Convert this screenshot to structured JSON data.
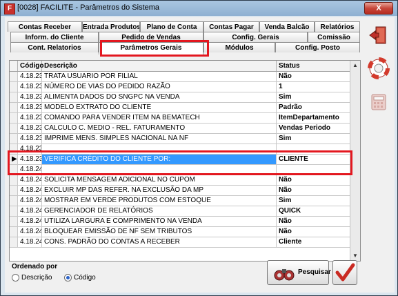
{
  "window": {
    "title": "[0028] FACILITE - Parâmetros do Sistema",
    "close_label": "X"
  },
  "tabs": {
    "row1": [
      "Contas Receber",
      "Entrada Produtos",
      "Plano de Conta",
      "Contas Pagar",
      "Venda Balcão",
      "Relatórios"
    ],
    "row2": [
      "Inform. do Cliente",
      "Pedido de Vendas",
      "Config. Gerais",
      "Comissão"
    ],
    "row3": [
      "Cont. Relatorios",
      "Parâmetros Gerais",
      "Módulos",
      "Config. Posto"
    ]
  },
  "grid": {
    "headers": [
      "Código",
      "Descrição",
      "Status"
    ],
    "rows": [
      {
        "code": "4.18.231",
        "desc": "TRATA USUARIO POR FILIAL",
        "status": "Não"
      },
      {
        "code": "4.18.232",
        "desc": "NÚMERO DE VIAS DO PEDIDO RAZÃO",
        "status": "1"
      },
      {
        "code": "4.18.233",
        "desc": "ALIMENTA DADOS DO SNGPC NA VENDA",
        "status": "Sim"
      },
      {
        "code": "4.18.234",
        "desc": "MODELO EXTRATO DO CLIENTE",
        "status": "Padrão"
      },
      {
        "code": "4.18.235",
        "desc": "COMANDO PARA VENDER ITEM NA BEMATECH",
        "status": "ItemDepartamento"
      },
      {
        "code": "4.18.236",
        "desc": "CALCULO C. MEDIO - REL. FATURAMENTO",
        "status": "Vendas Periodo"
      },
      {
        "code": "4.18.237",
        "desc": "IMPRIME MENS. SIMPLES NACIONAL NA NF",
        "status": "Sim"
      },
      {
        "code": "4.18.238",
        "desc": "",
        "status": ""
      },
      {
        "code": "4.18.239",
        "desc": "VERIFICA CRÉDITO DO CLIENTE POR:",
        "status": "CLIENTE"
      },
      {
        "code": "4.18.240",
        "desc": "",
        "status": ""
      },
      {
        "code": "4.18.241",
        "desc": "SOLICITA MENSAGEM ADICIONAL NO CUPOM",
        "status": "Não"
      },
      {
        "code": "4.18.242",
        "desc": "EXCLUIR MP DAS REFER. NA EXCLUSÃO DA MP",
        "status": "Não"
      },
      {
        "code": "4.18.243",
        "desc": "MOSTRAR EM VERDE PRODUTOS COM ESTOQUE",
        "status": "Sim"
      },
      {
        "code": "4.18.244",
        "desc": "GERENCIADOR DE RELATÓRIOS",
        "status": "QUICK"
      },
      {
        "code": "4.18.245",
        "desc": "UTILIZA LARGURA E COMPRIMENTO NA VENDA",
        "status": "Não"
      },
      {
        "code": "4.18.246",
        "desc": "BLOQUEAR EMISSÃO DE NF SEM TRIBUTOS",
        "status": "Não"
      },
      {
        "code": "4.18.247",
        "desc": "CONS. PADRÃO DO CONTAS A RECEBER",
        "status": "Cliente"
      }
    ],
    "selected_index": 8,
    "selected_marker": "▶"
  },
  "ordenado": {
    "label": "Ordenado por",
    "options": [
      "Descrição",
      "Código"
    ],
    "selected": "Código"
  },
  "buttons": {
    "pesquisar": "Pesquisar"
  },
  "icons": {
    "exit": "exit-door-icon",
    "help": "lifebuoy-icon",
    "calc": "calculator-icon",
    "search": "binoculars-icon",
    "ok": "checkmark-icon"
  },
  "colors": {
    "highlight": "#e3171f",
    "selection": "#3399ff"
  }
}
